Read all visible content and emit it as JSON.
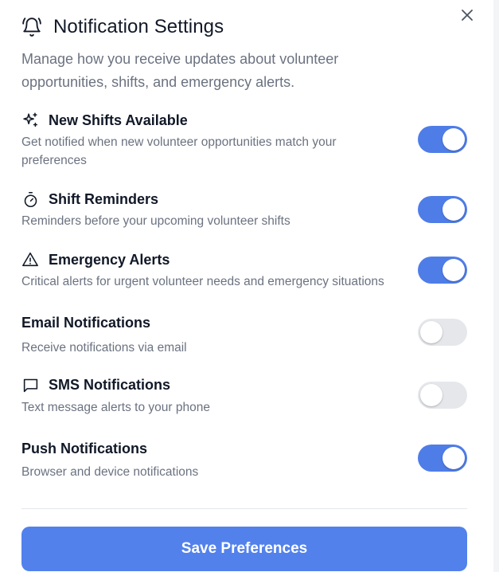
{
  "dialog": {
    "title": "Notification Settings",
    "description": "Manage how you receive updates about volunteer opportunities, shifts, and emergency alerts.",
    "close_icon": "close-icon",
    "title_icon": "bell-icon"
  },
  "settings": [
    {
      "label": "New Shifts Available",
      "description": "Get notified when new volunteer opportunities match your preferences",
      "icon": "sparkles-icon",
      "enabled": true
    },
    {
      "label": "Shift Reminders",
      "description": "Reminders before your upcoming volunteer shifts",
      "icon": "stopwatch-icon",
      "enabled": true
    },
    {
      "label": "Emergency Alerts",
      "description": "Critical alerts for urgent volunteer needs and emergency situations",
      "icon": "warning-icon",
      "enabled": true
    },
    {
      "label": "Email Notifications",
      "description": "Receive notifications via email",
      "icon": "",
      "enabled": false
    },
    {
      "label": "SMS Notifications",
      "description": "Text message alerts to your phone",
      "icon": "message-icon",
      "enabled": false
    },
    {
      "label": "Push Notifications",
      "description": "Browser and device notifications",
      "icon": "",
      "enabled": true
    }
  ],
  "footer": {
    "save_label": "Save Preferences"
  },
  "colors": {
    "accent": "#5281ec",
    "toggle_on": "#4f7de8",
    "toggle_off": "#e5e7eb",
    "muted_text": "#6b7280"
  }
}
